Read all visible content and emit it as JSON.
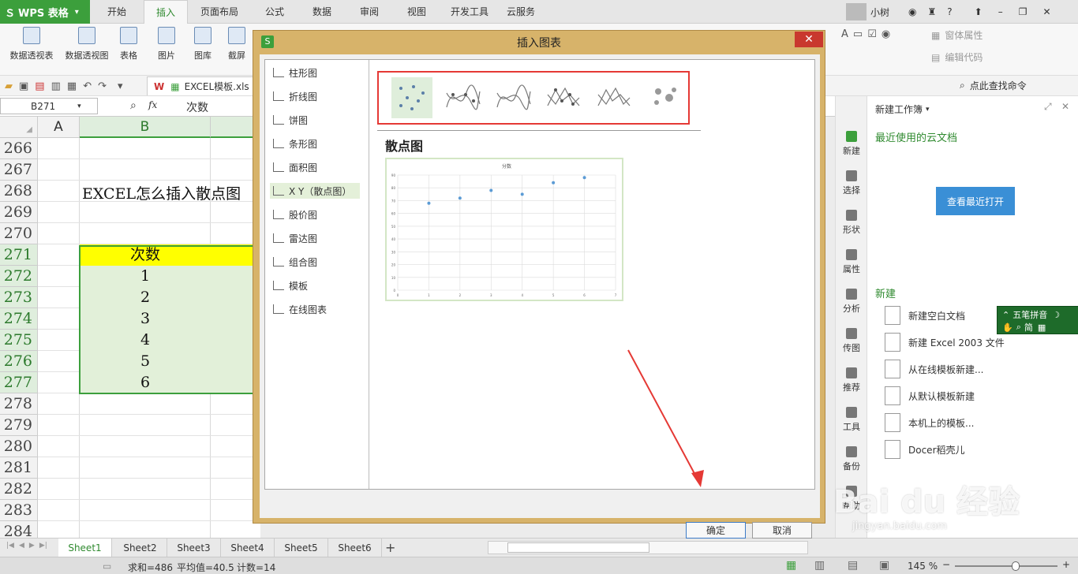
{
  "app": {
    "name": "WPS 表格"
  },
  "menu_tabs": [
    "开始",
    "插入",
    "页面布局",
    "公式",
    "数据",
    "审阅",
    "视图",
    "开发工具",
    "云服务"
  ],
  "active_menu_tab": "插入",
  "user": {
    "name": "小树"
  },
  "ribbon": {
    "buttons": [
      "数据透视表",
      "数据透视图",
      "表格",
      "图片",
      "图库",
      "截屏"
    ],
    "right_buttons": [
      "窗体属性",
      "编辑代码"
    ]
  },
  "quickbar": {
    "file_name": "EXCEL模板.xls",
    "find_command": "点此查找命令"
  },
  "formula_bar": {
    "cell_ref": "B271",
    "fx": "fx",
    "value": "次数"
  },
  "grid": {
    "col_a": "A",
    "col_b": "B",
    "title_text": "EXCEL怎么插入散点图",
    "header_cell": "次数",
    "rows": [
      {
        "num": "266",
        "b": ""
      },
      {
        "num": "267",
        "b": ""
      },
      {
        "num": "268",
        "b": ""
      },
      {
        "num": "269",
        "b": ""
      },
      {
        "num": "270",
        "b": ""
      },
      {
        "num": "271",
        "b": ""
      },
      {
        "num": "272",
        "b": "1"
      },
      {
        "num": "273",
        "b": "2"
      },
      {
        "num": "274",
        "b": "3"
      },
      {
        "num": "275",
        "b": "4"
      },
      {
        "num": "276",
        "b": "5"
      },
      {
        "num": "277",
        "b": "6"
      },
      {
        "num": "278",
        "b": ""
      },
      {
        "num": "279",
        "b": ""
      },
      {
        "num": "280",
        "b": ""
      },
      {
        "num": "281",
        "b": ""
      },
      {
        "num": "282",
        "b": ""
      },
      {
        "num": "283",
        "b": ""
      },
      {
        "num": "284",
        "b": ""
      }
    ]
  },
  "dialog": {
    "title": "插入图表",
    "categories": [
      "柱形图",
      "折线图",
      "饼图",
      "条形图",
      "面积图",
      "X Y（散点图）",
      "股价图",
      "雷达图",
      "组合图",
      "模板",
      "在线图表"
    ],
    "selected_category": "X Y（散点图）",
    "preview_title": "散点图",
    "ok_label": "确定",
    "cancel_label": "取消"
  },
  "chart_data": {
    "type": "scatter",
    "title": "分数",
    "x": [
      1,
      2,
      3,
      4,
      5,
      6
    ],
    "y": [
      68,
      72,
      78,
      75,
      84,
      88
    ],
    "xlim": [
      0,
      7
    ],
    "ylim": [
      0,
      90
    ],
    "x_ticks": [
      "0",
      "1",
      "2",
      "3",
      "4",
      "5",
      "6",
      "7"
    ],
    "y_ticks": [
      "0",
      "10",
      "20",
      "30",
      "40",
      "50",
      "60",
      "70",
      "80",
      "90"
    ],
    "grid": true,
    "color": "#5b9bd5"
  },
  "right_pane": {
    "header": "新建工作簿",
    "recent_label": "最近使用的云文档",
    "view_recent_button": "查看最近打开",
    "sidebar": [
      "新建",
      "选择",
      "形状",
      "属性",
      "分析",
      "传图",
      "推荐",
      "工具",
      "备份",
      "帮助"
    ],
    "new_section": "新建",
    "new_items": [
      "新建空白文档",
      "新建 Excel 2003 文件",
      "从在线模板新建...",
      "从默认模板新建",
      "本机上的模板...",
      "Docer稻壳儿"
    ]
  },
  "ime": {
    "label": "五笔拼音",
    "mode": "简"
  },
  "sheet_tabs": [
    "Sheet1",
    "Sheet2",
    "Sheet3",
    "Sheet4",
    "Sheet5",
    "Sheet6"
  ],
  "active_sheet": "Sheet1",
  "status": {
    "sum": "求和=486",
    "avg": "平均值=40.5",
    "count": "计数=14",
    "zoom": "145 %"
  },
  "watermark": {
    "brand": "Bai du 经验",
    "url": "jingyan.baidu.com"
  },
  "colors": {
    "accent": "#3c9f3c",
    "dialog_frame": "#d7b36a",
    "header_fill": "#ffff00",
    "data_fill": "#e2f0d9",
    "close_red": "#c9382e",
    "highlight_red": "#e53935"
  }
}
